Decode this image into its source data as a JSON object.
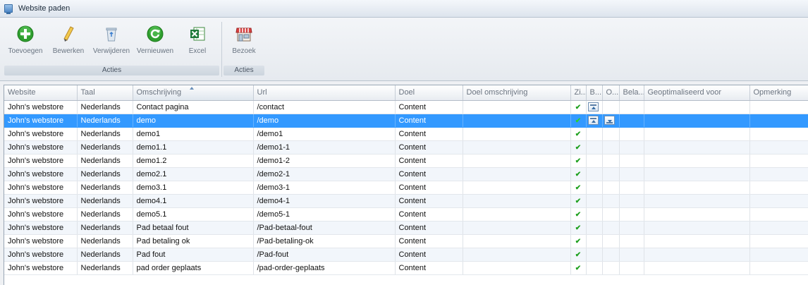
{
  "window": {
    "title": "Website paden",
    "icon": "window-icon"
  },
  "ribbon": {
    "groups": [
      {
        "label": "Acties",
        "buttons": [
          {
            "label": "Toevoegen",
            "icon": "add-icon"
          },
          {
            "label": "Bewerken",
            "icon": "pencil-icon"
          },
          {
            "label": "Verwijderen",
            "icon": "recycle-bin-icon"
          },
          {
            "label": "Vernieuwen",
            "icon": "refresh-icon"
          },
          {
            "label": "Excel",
            "icon": "excel-icon"
          }
        ]
      },
      {
        "label": "Acties",
        "buttons": [
          {
            "label": "Bezoek",
            "icon": "store-icon"
          }
        ]
      }
    ]
  },
  "grid": {
    "columns": [
      "Website",
      "Taal",
      "Omschrijving",
      "Url",
      "Doel",
      "Doel omschrijving",
      "Zi...",
      "B...",
      "O...",
      "Bela...",
      "Geoptimaliseerd voor",
      "Opmerking"
    ],
    "sorted_column": "Omschrijving",
    "selected_row": 1,
    "rows": [
      {
        "website": "John's webstore",
        "taal": "Nederlands",
        "omschrijving": "Contact pagina",
        "url": "/contact",
        "doel": "Content",
        "zichtbaar": "✔",
        "b_icon": "up",
        "o_icon": ""
      },
      {
        "website": "John's webstore",
        "taal": "Nederlands",
        "omschrijving": "demo",
        "url": "/demo",
        "doel": "Content",
        "zichtbaar": "✔",
        "b_icon": "up",
        "o_icon": "down"
      },
      {
        "website": "John's webstore",
        "taal": "Nederlands",
        "omschrijving": "demo1",
        "url": "/demo1",
        "doel": "Content",
        "zichtbaar": "✔",
        "b_icon": "",
        "o_icon": ""
      },
      {
        "website": "John's webstore",
        "taal": "Nederlands",
        "omschrijving": "demo1.1",
        "url": "/demo1-1",
        "doel": "Content",
        "zichtbaar": "✔",
        "b_icon": "",
        "o_icon": ""
      },
      {
        "website": "John's webstore",
        "taal": "Nederlands",
        "omschrijving": "demo1.2",
        "url": "/demo1-2",
        "doel": "Content",
        "zichtbaar": "✔",
        "b_icon": "",
        "o_icon": ""
      },
      {
        "website": "John's webstore",
        "taal": "Nederlands",
        "omschrijving": "demo2.1",
        "url": "/demo2-1",
        "doel": "Content",
        "zichtbaar": "✔",
        "b_icon": "",
        "o_icon": ""
      },
      {
        "website": "John's webstore",
        "taal": "Nederlands",
        "omschrijving": "demo3.1",
        "url": "/demo3-1",
        "doel": "Content",
        "zichtbaar": "✔",
        "b_icon": "",
        "o_icon": ""
      },
      {
        "website": "John's webstore",
        "taal": "Nederlands",
        "omschrijving": "demo4.1",
        "url": "/demo4-1",
        "doel": "Content",
        "zichtbaar": "✔",
        "b_icon": "",
        "o_icon": ""
      },
      {
        "website": "John's webstore",
        "taal": "Nederlands",
        "omschrijving": "demo5.1",
        "url": "/demo5-1",
        "doel": "Content",
        "zichtbaar": "✔",
        "b_icon": "",
        "o_icon": ""
      },
      {
        "website": "John's webstore",
        "taal": "Nederlands",
        "omschrijving": "Pad betaal fout",
        "url": "/Pad-betaal-fout",
        "doel": "Content",
        "zichtbaar": "✔",
        "b_icon": "",
        "o_icon": ""
      },
      {
        "website": "John's webstore",
        "taal": "Nederlands",
        "omschrijving": "Pad betaling ok",
        "url": "/Pad-betaling-ok",
        "doel": "Content",
        "zichtbaar": "✔",
        "b_icon": "",
        "o_icon": ""
      },
      {
        "website": "John's webstore",
        "taal": "Nederlands",
        "omschrijving": "Pad fout",
        "url": "/Pad-fout",
        "doel": "Content",
        "zichtbaar": "✔",
        "b_icon": "",
        "o_icon": ""
      },
      {
        "website": "John's webstore",
        "taal": "Nederlands",
        "omschrijving": "pad order geplaats",
        "url": "/pad-order-geplaats",
        "doel": "Content",
        "zichtbaar": "✔",
        "b_icon": "",
        "o_icon": ""
      }
    ]
  },
  "colors": {
    "selection": "#3399ff",
    "check": "#1ea01e",
    "alt_row": "#f2f6fb"
  }
}
